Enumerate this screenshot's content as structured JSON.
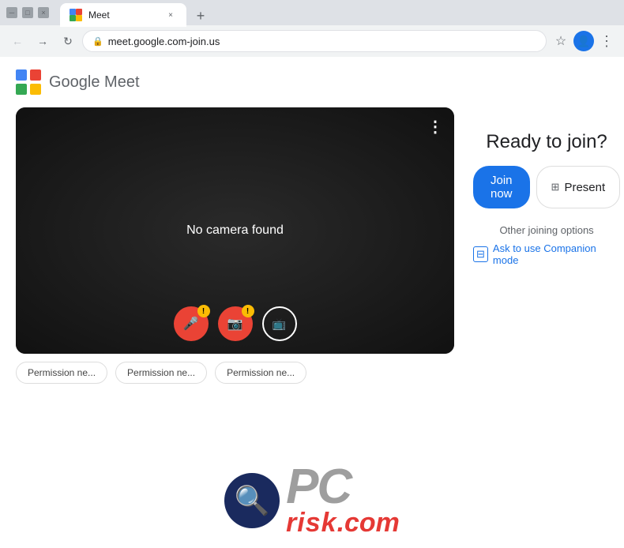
{
  "browser": {
    "tab": {
      "favicon": "🎥",
      "title": "Meet",
      "close_label": "×"
    },
    "new_tab_label": "+",
    "nav": {
      "back_label": "←",
      "forward_label": "→",
      "reload_label": "↻",
      "url": "meet.google.com-join.us",
      "star_label": "☆",
      "profile_label": "👤",
      "menu_label": "⋮"
    }
  },
  "meet": {
    "logo_text": "Google Meet",
    "video": {
      "no_camera_text": "No camera found",
      "more_options_label": "⋮",
      "controls": {
        "mic_badge": "!",
        "cam_badge": "!"
      }
    },
    "permissions": [
      "Permission ne...",
      "Permission ne...",
      "Permission ne..."
    ],
    "panel": {
      "ready_title": "Ready to join?",
      "join_now_label": "Join now",
      "present_label": "Present",
      "other_options_label": "Other joining options",
      "companion_label": "Ask to use Companion mode"
    }
  },
  "watermark": {
    "pc_text": "PC",
    "risk_text": "risk",
    "dotcom_text": ".com"
  }
}
